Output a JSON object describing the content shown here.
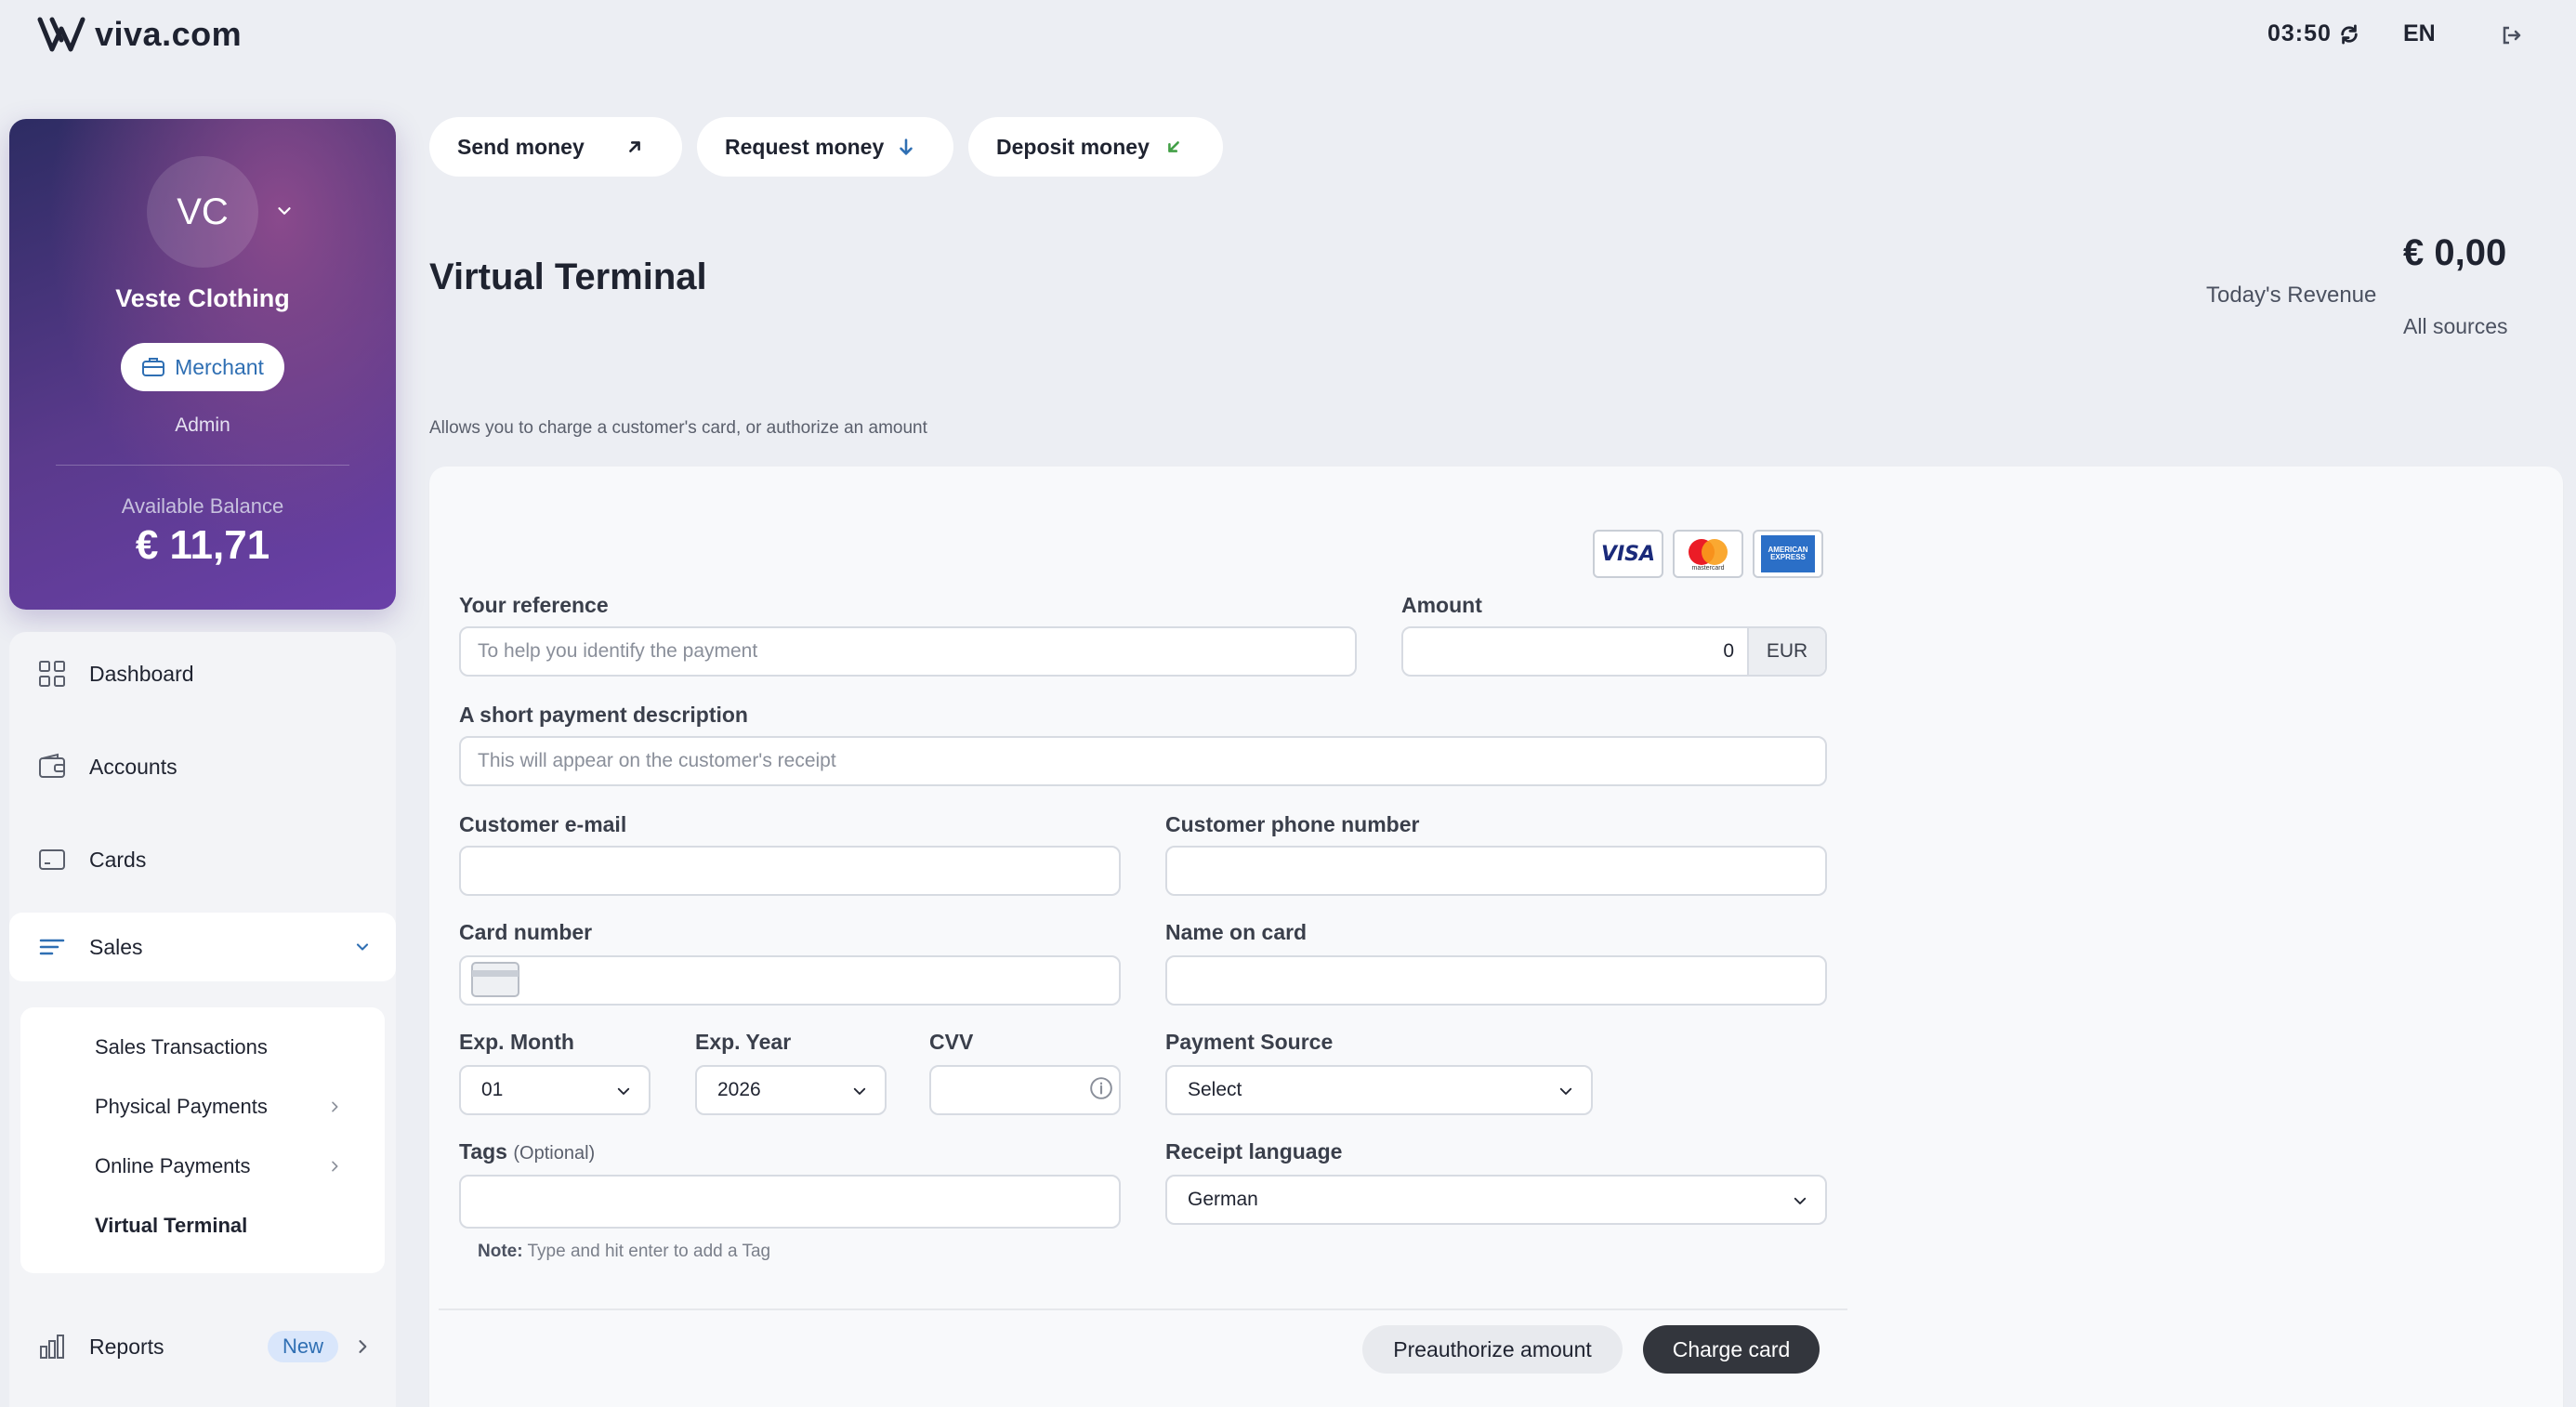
{
  "app": {
    "logo_text": "viva.com",
    "clock": "03:50",
    "language": "EN"
  },
  "profile": {
    "initials": "VC",
    "name": "Veste Clothing",
    "badge": "Merchant",
    "role": "Admin",
    "balance_label": "Available Balance",
    "balance_value": "€ 11,71"
  },
  "sidebar": {
    "items": [
      {
        "label": "Dashboard",
        "icon": "grid-icon"
      },
      {
        "label": "Accounts",
        "icon": "wallet-icon"
      },
      {
        "label": "Cards",
        "icon": "card-icon"
      },
      {
        "label": "Sales",
        "icon": "list-icon"
      },
      {
        "label": "Reports",
        "icon": "bar-chart-icon",
        "badge": "New"
      }
    ],
    "sales_sub": [
      {
        "label": "Sales Transactions"
      },
      {
        "label": "Physical Payments"
      },
      {
        "label": "Online Payments"
      },
      {
        "label": "Virtual Terminal"
      }
    ]
  },
  "actions": {
    "send": "Send money",
    "request": "Request money",
    "deposit": "Deposit money"
  },
  "page": {
    "title": "Virtual Terminal",
    "description": "Allows you to charge a customer's card, or authorize an amount",
    "revenue_value": "€ 0,00",
    "revenue_label": "Today's Revenue",
    "revenue_source": "All sources"
  },
  "form": {
    "card_brands": [
      "VISA",
      "mastercard",
      "AMERICAN EXPRESS"
    ],
    "reference_label": "Your reference",
    "reference_placeholder": "To help you identify the payment",
    "amount_label": "Amount",
    "amount_value": "0",
    "amount_currency": "EUR",
    "description_label": "A short payment description",
    "description_placeholder": "This will appear on the customer's receipt",
    "email_label": "Customer e-mail",
    "phone_label": "Customer phone number",
    "card_number_label": "Card number",
    "name_on_card_label": "Name on card",
    "exp_month_label": "Exp. Month",
    "exp_month_value": "01",
    "exp_year_label": "Exp. Year",
    "exp_year_value": "2026",
    "cvv_label": "CVV",
    "payment_source_label": "Payment Source",
    "payment_source_value": "Select",
    "tags_label": "Tags",
    "tags_optional": "(Optional)",
    "receipt_language_label": "Receipt language",
    "receipt_language_value": "German",
    "note_label": "Note:",
    "note_text": "Type and hit enter to add a Tag",
    "preauthorize_button": "Preauthorize amount",
    "charge_button": "Charge card"
  },
  "colors": {
    "accent_blue": "#2f6fb3",
    "primary_button": "#33363d",
    "deposit_green": "#43a047"
  }
}
